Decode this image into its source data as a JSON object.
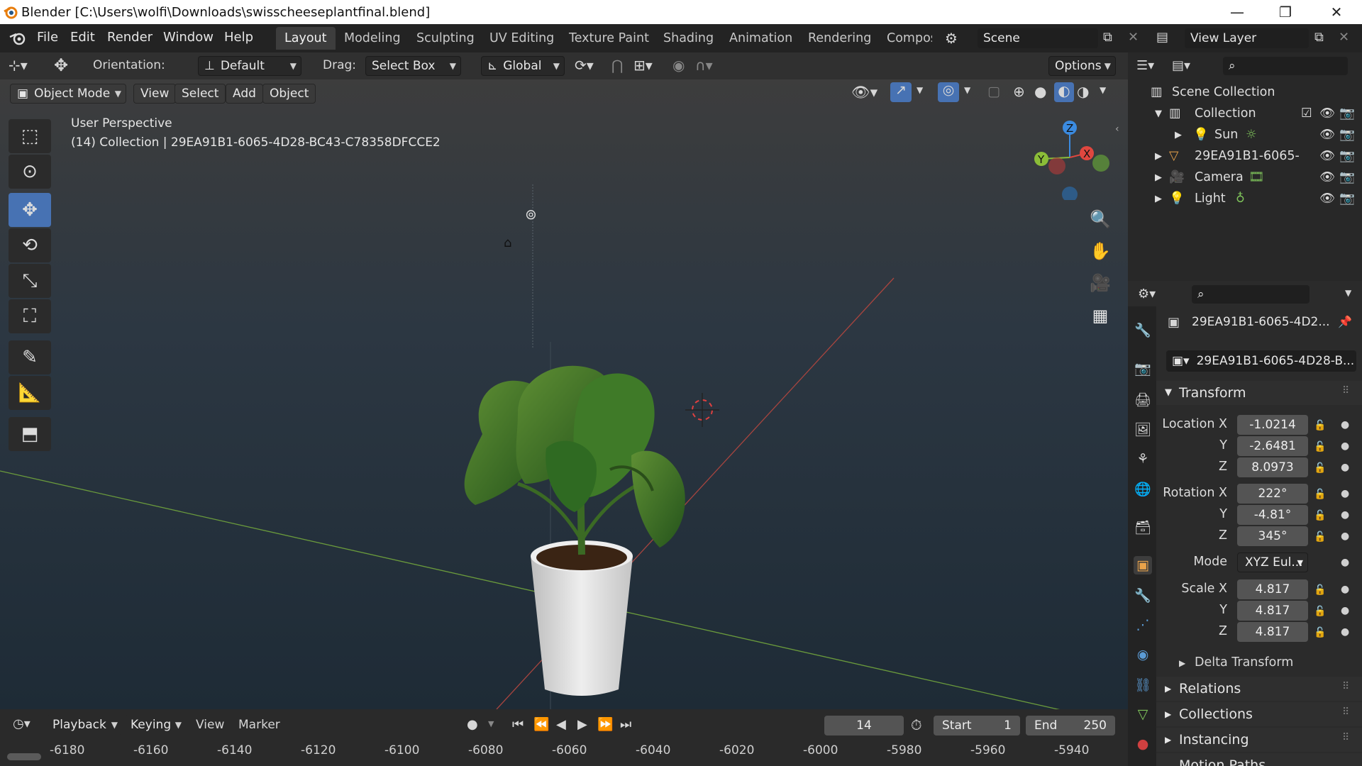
{
  "window": {
    "title": "Blender [C:\\Users\\wolfi\\Downloads\\swisscheeseplantfinal.blend]",
    "minimize": "—",
    "maximize": "❐",
    "close": "✕"
  },
  "menu": [
    "File",
    "Edit",
    "Render",
    "Window",
    "Help"
  ],
  "workspaces": [
    "Layout",
    "Modeling",
    "Sculpting",
    "UV Editing",
    "Texture Paint",
    "Shading",
    "Animation",
    "Rendering",
    "Compos"
  ],
  "scene": {
    "name": "Scene",
    "view_layer": "View Layer"
  },
  "header": {
    "orientation_label": "Orientation:",
    "orientation_value": "Default",
    "drag_label": "Drag:",
    "drag_value": "Select Box",
    "transform_value": "Global",
    "options": "Options"
  },
  "viewport_header": {
    "mode": "Object Mode",
    "menus": [
      "View",
      "Select",
      "Add",
      "Object"
    ]
  },
  "viewport": {
    "perspective": "User Perspective",
    "info": "(14) Collection | 29EA91B1-6065-4D28-BC43-C78358DFCCE2",
    "gizmo": {
      "z": "Z",
      "y": "Y",
      "x": "X"
    }
  },
  "outliner": {
    "root": "Scene Collection",
    "items": [
      {
        "label": "Collection",
        "level": 1
      },
      {
        "label": "Sun",
        "level": 2
      },
      {
        "label": "29EA91B1-6065-",
        "level": 1
      },
      {
        "label": "Camera",
        "level": 1
      },
      {
        "label": "Light",
        "level": 1
      }
    ]
  },
  "properties": {
    "object_name": "29EA91B1-6065-4D2...",
    "data_name": "29EA91B1-6065-4D28-B...",
    "transform_title": "Transform",
    "location_label": "Location X",
    "location": [
      "-1.0214",
      "-2.6481",
      "8.0973"
    ],
    "rotation_label": "Rotation X",
    "rotation": [
      "222°",
      "-4.81°",
      "345°"
    ],
    "mode_label": "Mode",
    "mode_value": "XYZ Eul...",
    "scale_label": "Scale X",
    "scale": [
      "4.817",
      "4.817",
      "4.817"
    ],
    "axis_y": "Y",
    "axis_z": "Z",
    "panels": [
      "Delta Transform",
      "Relations",
      "Collections",
      "Instancing",
      "Motion Paths"
    ]
  },
  "timeline": {
    "menus": [
      "Playback",
      "Keying",
      "View",
      "Marker"
    ],
    "current_frame": "14",
    "start_label": "Start",
    "start": "1",
    "end_label": "End",
    "end": "250",
    "ticks": [
      "-6180",
      "-6160",
      "-6140",
      "-6120",
      "-6100",
      "-6080",
      "-6060",
      "-6040",
      "-6020",
      "-6000",
      "-5980",
      "-5960",
      "-5940"
    ]
  },
  "colors": {
    "accent": "#4772b3",
    "x_axis": "#e0473f",
    "y_axis": "#8bbd38",
    "z_axis": "#3b8be0"
  }
}
